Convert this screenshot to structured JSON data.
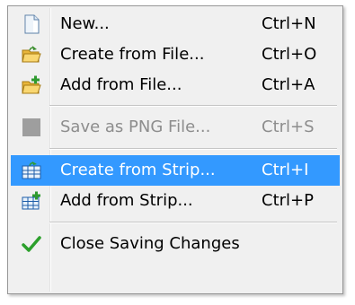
{
  "colors": {
    "menu_background": "#f0f0f0",
    "highlight": "#3399ff",
    "disabled_text": "#8d8d8d",
    "check_green": "#2ca02c"
  },
  "menu": {
    "items": [
      {
        "label": "New...",
        "shortcut": "Ctrl+N",
        "icon": "new-document-icon",
        "enabled": true,
        "highlighted": false
      },
      {
        "label": "Create from File...",
        "shortcut": "Ctrl+O",
        "icon": "open-folder-icon",
        "enabled": true,
        "highlighted": false
      },
      {
        "label": "Add from File...",
        "shortcut": "Ctrl+A",
        "icon": "add-folder-icon",
        "enabled": true,
        "highlighted": false
      },
      {
        "label": "Save as PNG File...",
        "shortcut": "Ctrl+S",
        "icon": "save-png-icon",
        "enabled": false,
        "highlighted": false
      },
      {
        "label": "Create from Strip...",
        "shortcut": "Ctrl+I",
        "icon": "create-strip-icon",
        "enabled": true,
        "highlighted": true
      },
      {
        "label": "Add from Strip...",
        "shortcut": "Ctrl+P",
        "icon": "add-strip-icon",
        "enabled": true,
        "highlighted": false
      },
      {
        "label": "Close Saving Changes",
        "shortcut": "",
        "icon": "checkmark-icon",
        "enabled": true,
        "highlighted": false
      }
    ]
  }
}
